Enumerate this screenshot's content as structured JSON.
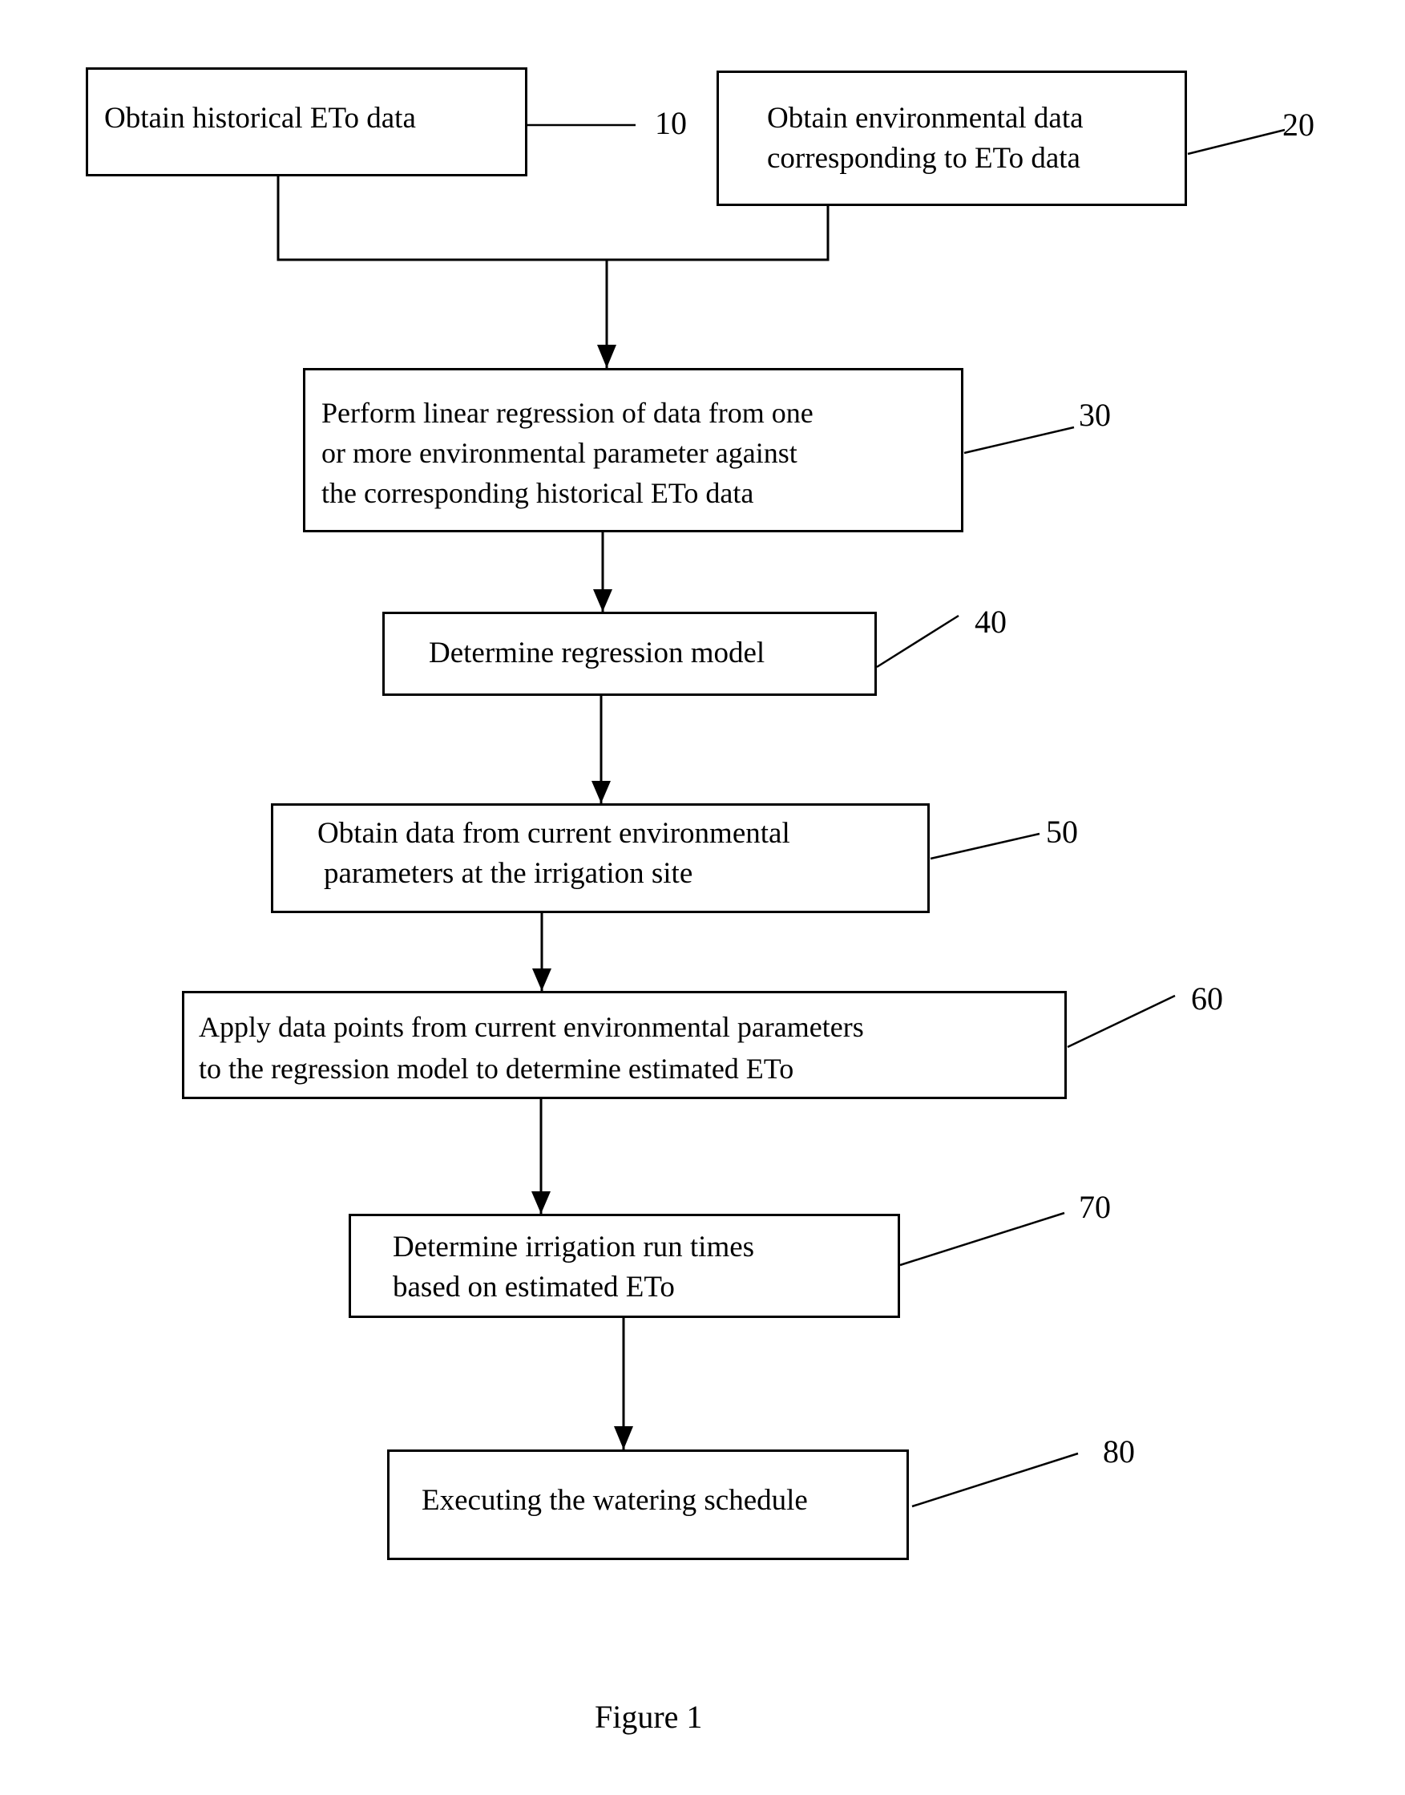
{
  "figure": {
    "caption": "Figure 1",
    "steps": [
      {
        "ref": "10",
        "lines": [
          "Obtain historical ETo data"
        ]
      },
      {
        "ref": "20",
        "lines": [
          "Obtain environmental data",
          "corresponding to ETo data"
        ]
      },
      {
        "ref": "30",
        "lines": [
          "Perform linear regression of data from one",
          "or more environmental parameter against",
          "the corresponding historical ETo data"
        ]
      },
      {
        "ref": "40",
        "lines": [
          "Determine regression model"
        ]
      },
      {
        "ref": "50",
        "lines": [
          "Obtain data from current environmental",
          "parameters at the irrigation site"
        ]
      },
      {
        "ref": "60",
        "lines": [
          "Apply data points from current environmental parameters",
          "to the regression model to determine estimated ETo"
        ]
      },
      {
        "ref": "70",
        "lines": [
          "Determine irrigation run times",
          "based on estimated ETo"
        ]
      },
      {
        "ref": "80",
        "lines": [
          "Executing the watering schedule"
        ]
      }
    ],
    "flow": [
      {
        "from": [
          "10",
          "20"
        ],
        "to": "30",
        "type": "merge-arrow"
      },
      {
        "from": "30",
        "to": "40",
        "type": "arrow"
      },
      {
        "from": "40",
        "to": "50",
        "type": "arrow"
      },
      {
        "from": "50",
        "to": "60",
        "type": "arrow"
      },
      {
        "from": "60",
        "to": "70",
        "type": "arrow"
      },
      {
        "from": "70",
        "to": "80",
        "type": "arrow"
      }
    ]
  }
}
